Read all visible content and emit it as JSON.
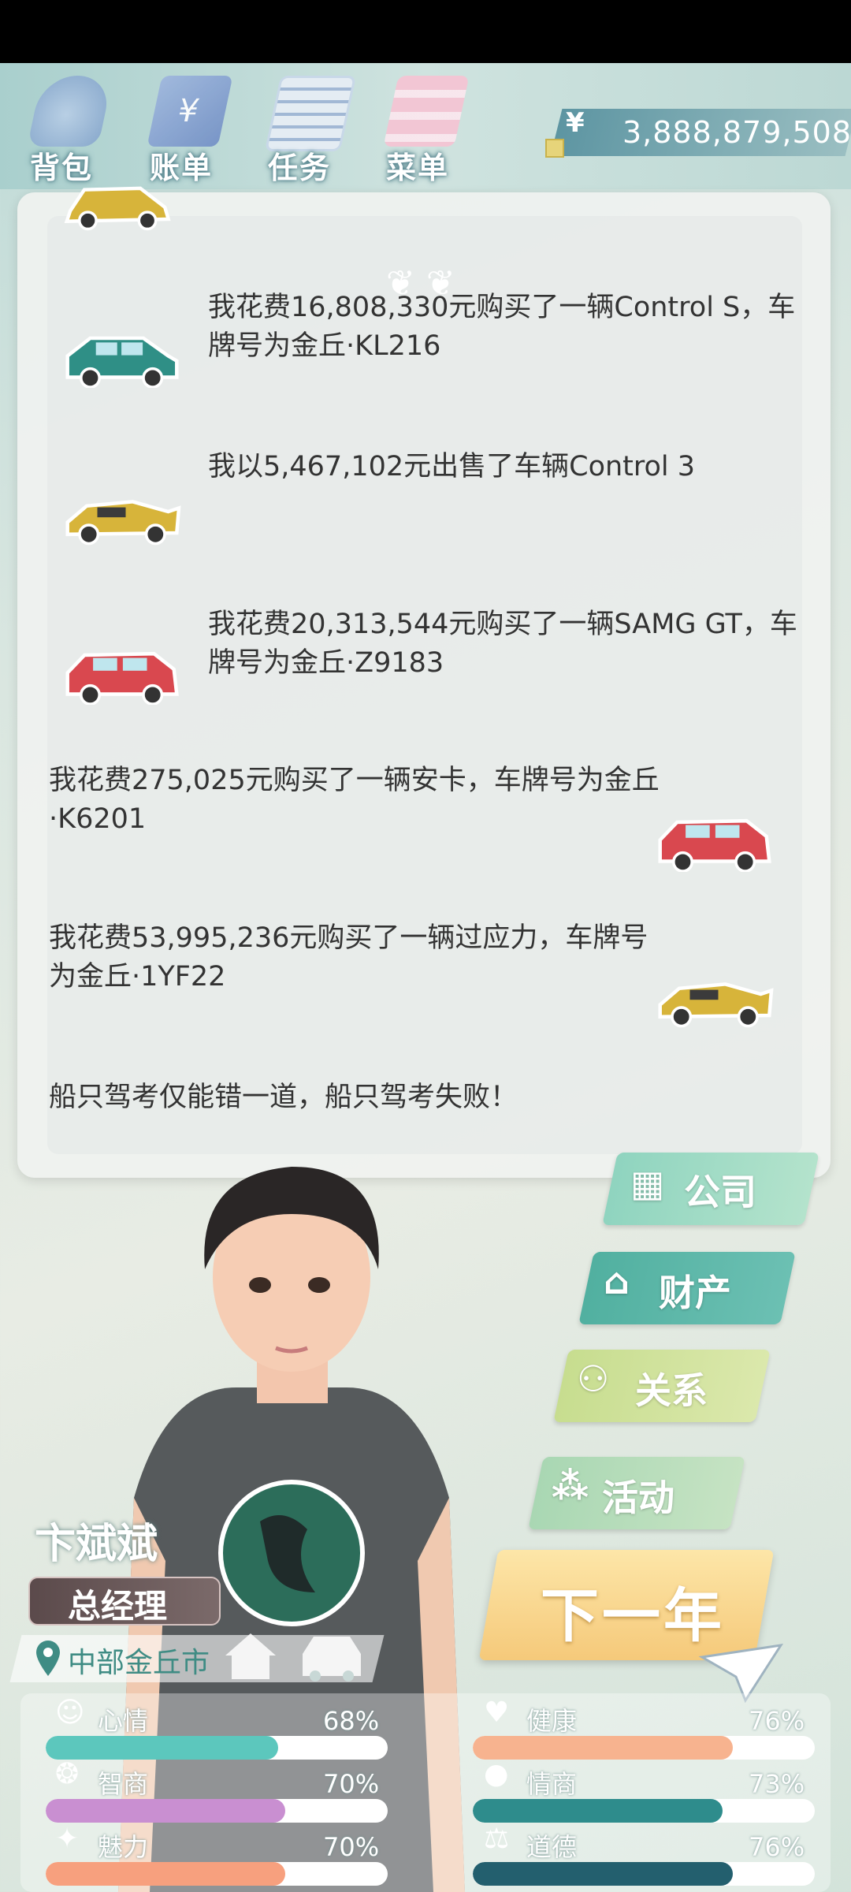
{
  "topbar": {
    "items": [
      {
        "label": "背包",
        "icon": "backpack-icon"
      },
      {
        "label": "账单",
        "icon": "bill-icon"
      },
      {
        "label": "任务",
        "icon": "task-icon"
      },
      {
        "label": "菜单",
        "icon": "menu-icon"
      }
    ],
    "money_symbol": "¥",
    "money": "3,888,879,508"
  },
  "log": {
    "entries": [
      {
        "text": "我花费16,808,330元购买了一辆Control S，车牌号为金丘·KL216",
        "car_color": "#2f8f86"
      },
      {
        "text": "我以5,467,102元出售了车辆Control 3",
        "car_color": "#d7b43a"
      },
      {
        "text": "我花费20,313,544元购买了一辆SAMG GT，车牌号为金丘·Z9183",
        "car_color": "#d9484f"
      },
      {
        "text": "我花费275,025元购买了一辆安卡，车牌号为金丘·K6201",
        "car_color": "#d9484f"
      },
      {
        "text": "我花费53,995,236元购买了一辆过应力，车牌号为金丘·1YF22",
        "car_color": "#d7b43a"
      },
      {
        "text": "船只驾考仅能错一道，船只驾考失败！"
      }
    ]
  },
  "menu": {
    "company": "公司",
    "property": "财产",
    "relation": "关系",
    "activity": "活动",
    "next_year": "下一年"
  },
  "player": {
    "name": "卞斌斌",
    "title": "总经理",
    "location": "中部金丘市"
  },
  "stats": [
    {
      "label": "心情",
      "value": "68%",
      "fill": 0.68,
      "color": "#5cc7bd",
      "icon": "smile-icon"
    },
    {
      "label": "健康",
      "value": "76%",
      "fill": 0.76,
      "color": "#f7b38f",
      "icon": "heart-icon"
    },
    {
      "label": "智商",
      "value": "70%",
      "fill": 0.7,
      "color": "#c98fd1",
      "icon": "brain-icon"
    },
    {
      "label": "情商",
      "value": "73%",
      "fill": 0.73,
      "color": "#2e8c8c",
      "icon": "apple-icon"
    },
    {
      "label": "魅力",
      "value": "70%",
      "fill": 0.7,
      "color": "#f7a07e",
      "icon": "star-icon"
    },
    {
      "label": "道德",
      "value": "76%",
      "fill": 0.76,
      "color": "#235f6e",
      "icon": "scale-icon"
    }
  ]
}
